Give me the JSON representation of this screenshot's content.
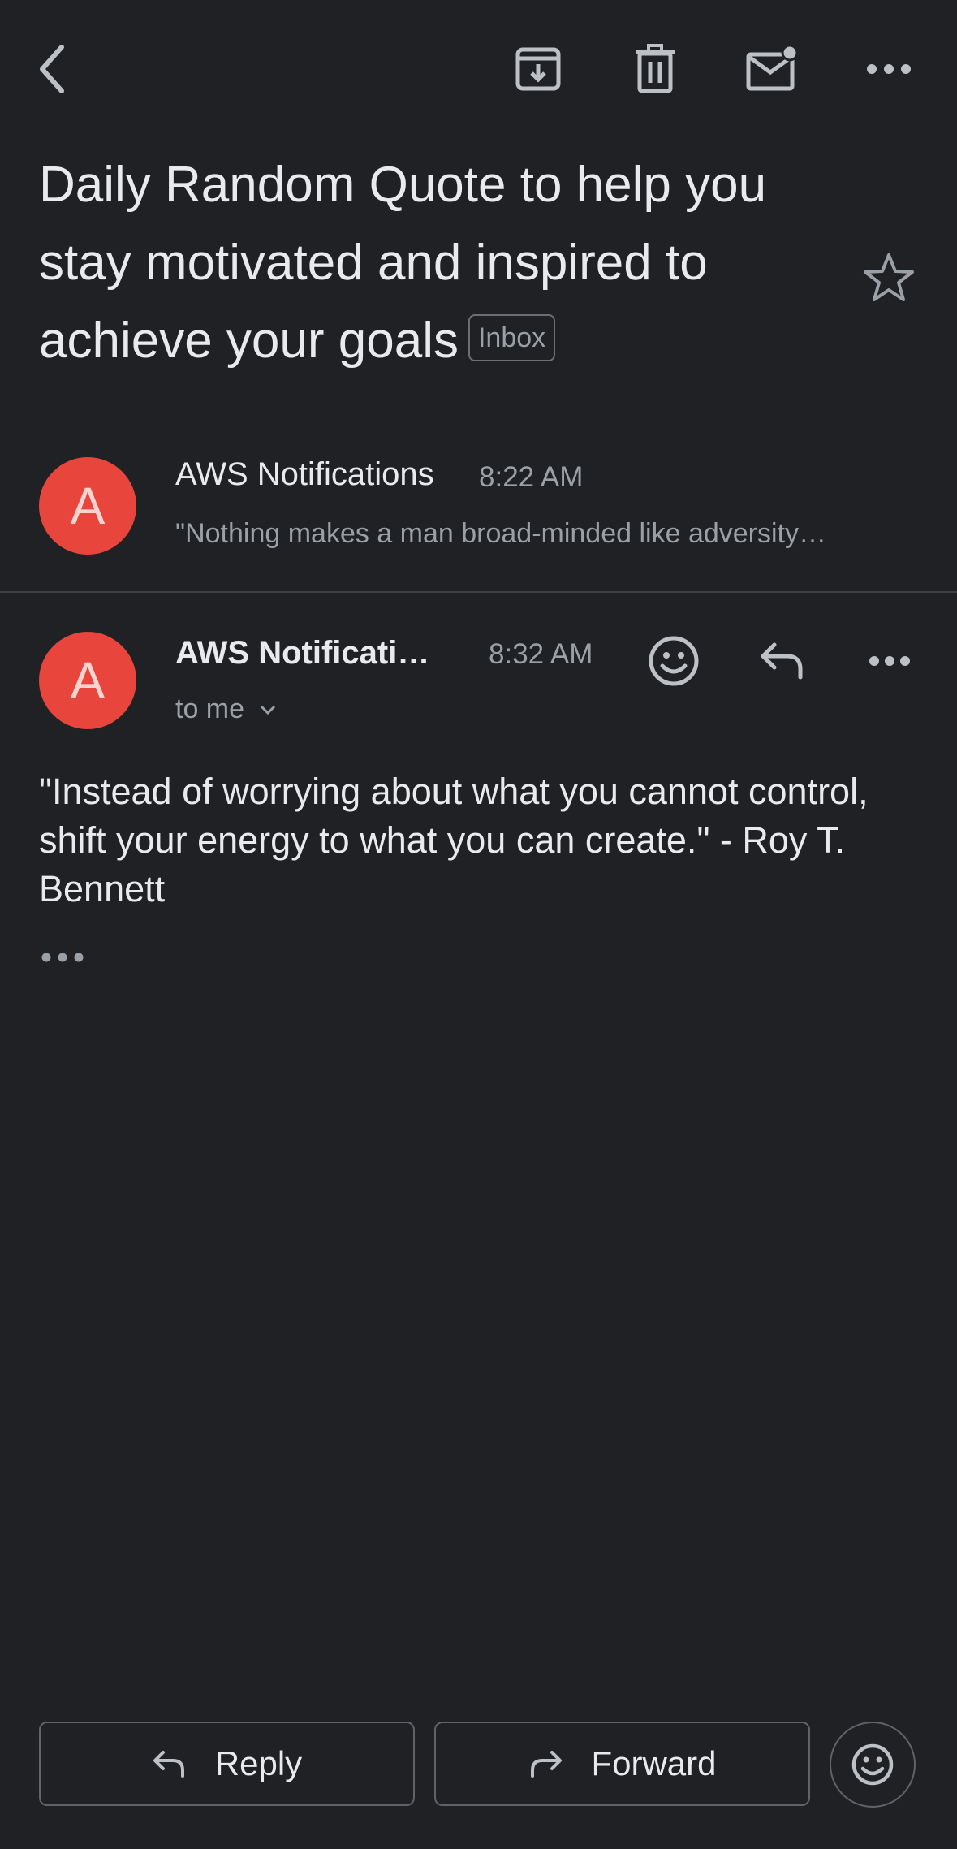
{
  "toolbar": {
    "icons": [
      "back-arrow-icon",
      "archive-icon",
      "trash-icon",
      "mark-unread-icon",
      "more-options-icon"
    ]
  },
  "subject": {
    "text": "Daily Random Quote to help you stay motivated and inspired to achieve your goals",
    "label": "Inbox"
  },
  "messages": [
    {
      "avatar_letter": "A",
      "sender": "AWS Notifications",
      "time": "8:22 AM",
      "snippet": "\"Nothing makes a man broad-minded like adversity…"
    },
    {
      "avatar_letter": "A",
      "sender": "AWS Notificati…",
      "time": "8:32 AM",
      "recipient": "to me",
      "body": "\"Instead of worrying about what you cannot control, shift your energy to what you can create.\" - Roy T. Bennett"
    }
  ],
  "actions": {
    "reply_label": "Reply",
    "forward_label": "Forward"
  },
  "colors": {
    "background": "#202124",
    "avatar": "#e8453c",
    "text_primary": "#e8eaed",
    "text_secondary": "#9aa0a6"
  }
}
